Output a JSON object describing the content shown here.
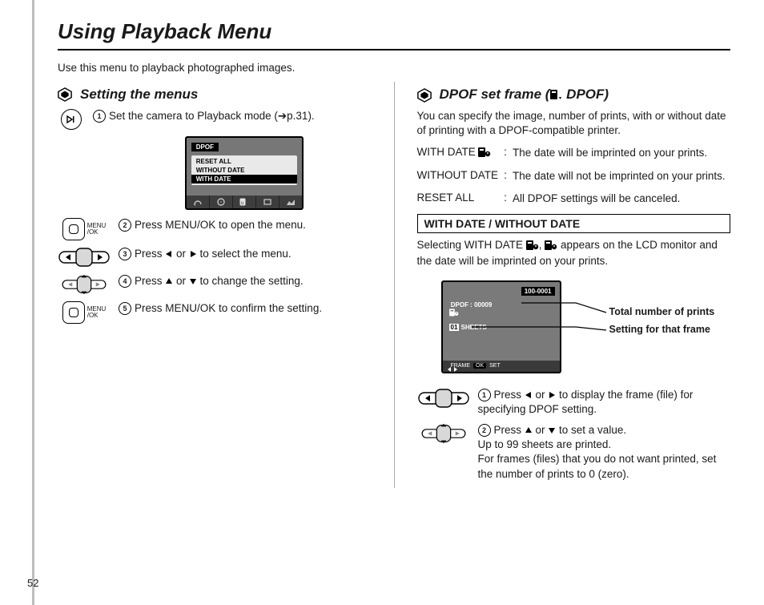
{
  "page_number": "52",
  "title": "Using Playback Menu",
  "intro": "Use this menu to playback photographed images.",
  "left": {
    "heading": "Setting the menus",
    "lcd": {
      "top_label": "DPOF",
      "rows": [
        "RESET ALL",
        "WITHOUT DATE",
        "WITH DATE"
      ]
    },
    "steps": {
      "s1_num": "1",
      "s1": "Set the camera to Playback mode (➔p.31).",
      "s2_num": "2",
      "s2": "Press MENU/OK to open the menu.",
      "s3_num": "3",
      "s3_a": "Press ",
      "s3_b": " or ",
      "s3_c": " to select the menu.",
      "s4_num": "4",
      "s4_a": "Press ",
      "s4_b": " or ",
      "s4_c": " to change the setting.",
      "s5_num": "5",
      "s5": "Press MENU/OK to confirm the setting."
    },
    "ok_label_top": "MENU",
    "ok_label_bottom": "/OK"
  },
  "right": {
    "heading_a": "DPOF set frame (",
    "heading_b": " DPOF)",
    "lead": "You can specify the image, number of prints, with or without date of printing with a DPOF-compatible printer.",
    "dl": {
      "k1": "WITH DATE",
      "v1": "The date will be imprinted on your prints.",
      "k2": "WITHOUT DATE",
      "v2": "The date will not be imprinted on your prints.",
      "k3": "RESET ALL",
      "v3": "All DPOF settings will be canceled."
    },
    "box_head": "WITH DATE / WITHOUT DATE",
    "sub_a": "Selecting WITH DATE ",
    "sub_b": ", ",
    "sub_c": " appears on the LCD monitor and the date will be imprinted on your prints.",
    "lcd2": {
      "badge": "100-0001",
      "dpof_label": "DPOF :",
      "dpof_value": "00009",
      "sheets_count": "01",
      "sheets_label": "SHEETS",
      "footer_frame": "FRAME",
      "footer_set": "SET",
      "footer_ok": "OK"
    },
    "callout1": "Total number of prints",
    "callout2": "Setting for that frame",
    "steps": {
      "s1_num": "1",
      "s1_a": "Press ",
      "s1_b": " or ",
      "s1_c": " to display the frame (file) for specifying DPOF setting.",
      "s2_num": "2",
      "s2_a": "Press ",
      "s2_b": " or ",
      "s2_c": " to set a value.",
      "s2_d": "Up to 99 sheets are printed.",
      "s2_e": "For frames (files) that you do not want printed, set the number of prints to 0 (zero)."
    }
  }
}
